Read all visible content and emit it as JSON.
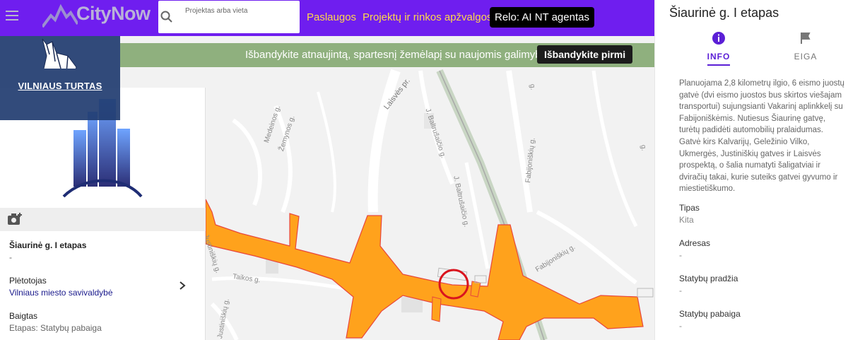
{
  "topbar": {
    "brand": "CityNow",
    "search_placeholder": "Projektas arba vieta",
    "nav": {
      "services": "Paslaugos",
      "reviews": "Projektų ir rinkos apžvalgos",
      "relo": "Relo: AI NT agentas"
    },
    "colors": {
      "bar": "#6f1eef",
      "nav_link": "#ffd84a"
    }
  },
  "banner": {
    "text": "Išbandykite atnaujintą, spartesnį žemėlapį su naujomis galimybėmis",
    "button": "Išbandykite pirmi"
  },
  "overlay_logo": {
    "caption": "VILNIAUS TURTAS"
  },
  "left_card": {
    "project_name": "Šiaurinė g. I etapas",
    "project_sub": "-",
    "developer_label": "Plėtotojas",
    "developer_value": "Vilniaus miesto savivaldybė",
    "finished_label": "Baigtas",
    "finished_value": "Etapas: Statybų pabaiga"
  },
  "map": {
    "streets": {
      "laisves": "Laisvės pr.",
      "baltrusaicio_1": "J. Baltrušaičio g.",
      "baltrusaicio_2": "J. Baltrušaičio g.",
      "medeinos": "Medeinos g.",
      "zemynos": "Žemynos g.",
      "fabijoniskiu_1": "Fabijoniškių g.",
      "fabijoniskiu_2": "Fabijoniškių g.",
      "taikos": "Taikos g.",
      "justiniskiu_1": "Justiniškių g.",
      "justiniskiu_2": "Justiniškių g.",
      "edge_g_1": "g.",
      "edge_g_2": "g."
    },
    "colors": {
      "project": "#ffa21c",
      "project_outline": "#e8463c",
      "marker": "#d9141e"
    }
  },
  "right_panel": {
    "title": "Šiaurinė g. I etapas",
    "tabs": {
      "info": "INFO",
      "eiga": "EIGA"
    },
    "description": "Planuojama 2,8 kilometrų ilgio, 6 eismo juostų gatvė (dvi eismo juostos bus skirtos viešajam transportui) sujungsianti Vakarinį aplinkkelį su Fabijoniškėmis. Nutiesus Šiaurinę gatvę, turėtų padidėti automobilių pralaidumas. Gatvė kirs Kalvarijų, Geležinio Vilko, Ukmergės, Justiniškių gatves ir Laisvės prospektą, o šalia numatyti šaligatviai ir dviračių takai, kurie suteiks gatvei gyvumo ir miestietiškumo.",
    "fields": {
      "type_label": "Tipas",
      "type_value": "Kita",
      "address_label": "Adresas",
      "address_value": "-",
      "start_label": "Statybų pradžia",
      "start_value": "-",
      "end_label": "Statybų pabaiga",
      "end_value": "-"
    }
  }
}
